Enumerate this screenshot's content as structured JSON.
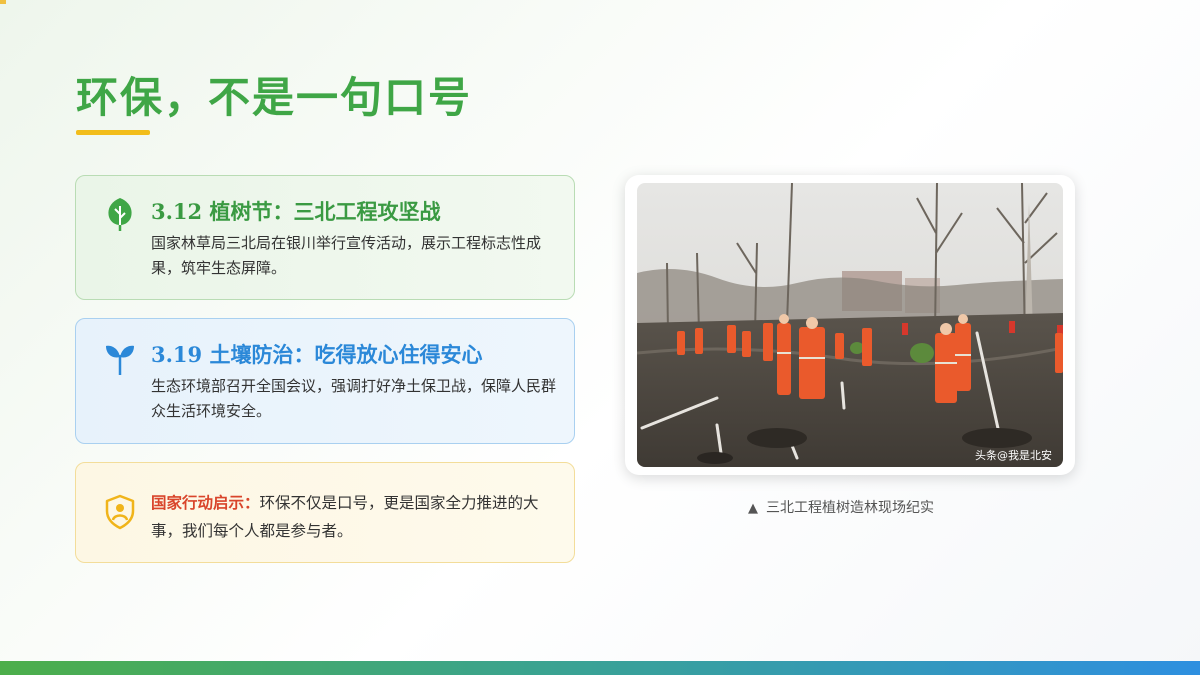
{
  "title": "环保，不是一句口号",
  "cards": [
    {
      "title": "3.12  植树节：三北工程攻坚战",
      "text": "国家林草局三北局在银川举行宣传活动，展示工程标志性成果，筑牢生态屏障。",
      "icon": "tree-icon",
      "accent": "#3a9a42"
    },
    {
      "title": "3.19  土壤防治：吃得放心住得安心",
      "text": "生态环境部召开全国会议，强调打好净土保卫战，保障人民群众生活环境安全。",
      "icon": "sprout-icon",
      "accent": "#2b88d8"
    },
    {
      "highlight": "国家行动启示：",
      "text": "环保不仅是口号，更是国家全力推进的大事，我们每个人都是参与者。",
      "icon": "shield-person-icon",
      "accent": "#d9452b"
    }
  ],
  "photo": {
    "watermark": "头条@我是北安"
  },
  "caption": "三北工程植树造林现场纪实",
  "colors": {
    "title": "#3fa646",
    "underline": "#f2bd1b",
    "bar_start": "#4cae4a",
    "bar_end": "#2e8fe0"
  }
}
